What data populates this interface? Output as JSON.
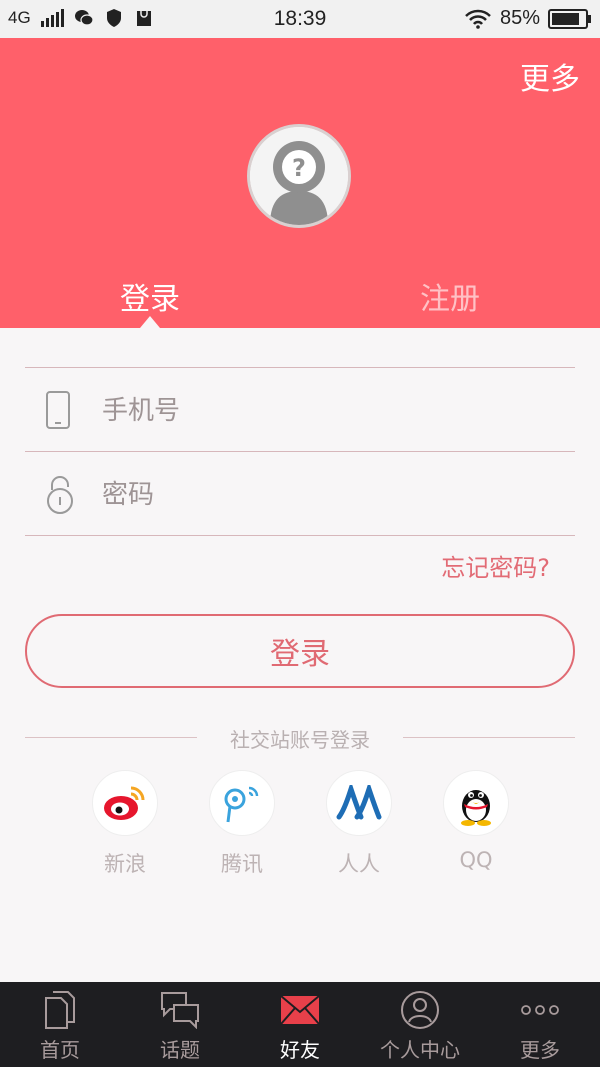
{
  "status_bar": {
    "network": "4G",
    "time": "18:39",
    "battery": "85%",
    "battery_level": 0.85
  },
  "header": {
    "more_label": "更多",
    "avatar_icon": "default-avatar-question-icon",
    "tabs": [
      {
        "label": "登录",
        "active": true
      },
      {
        "label": "注册",
        "active": false
      }
    ]
  },
  "form": {
    "phone": {
      "placeholder": "手机号",
      "value": "",
      "icon": "phone-icon"
    },
    "password": {
      "placeholder": "密码",
      "value": "",
      "icon": "lock-icon"
    },
    "forgot_label": "忘记密码?",
    "login_label": "登录"
  },
  "social": {
    "title": "社交站账号登录",
    "items": [
      {
        "label": "新浪",
        "icon": "weibo-icon"
      },
      {
        "label": "腾讯",
        "icon": "tencent-weibo-icon"
      },
      {
        "label": "人人",
        "icon": "renren-icon"
      },
      {
        "label": "QQ",
        "icon": "qq-icon"
      }
    ]
  },
  "bottom_nav": {
    "items": [
      {
        "label": "首页",
        "icon": "documents-icon",
        "active": false
      },
      {
        "label": "话题",
        "icon": "chat-bubbles-icon",
        "active": false
      },
      {
        "label": "好友",
        "icon": "envelope-icon",
        "active": true
      },
      {
        "label": "个人中心",
        "icon": "user-icon",
        "active": false
      },
      {
        "label": "更多",
        "icon": "more-dots-icon",
        "active": false
      }
    ]
  },
  "colors": {
    "brand_red": "#ff606a",
    "accent_pink": "#e06a73",
    "nav_bg": "#1e1e21"
  }
}
